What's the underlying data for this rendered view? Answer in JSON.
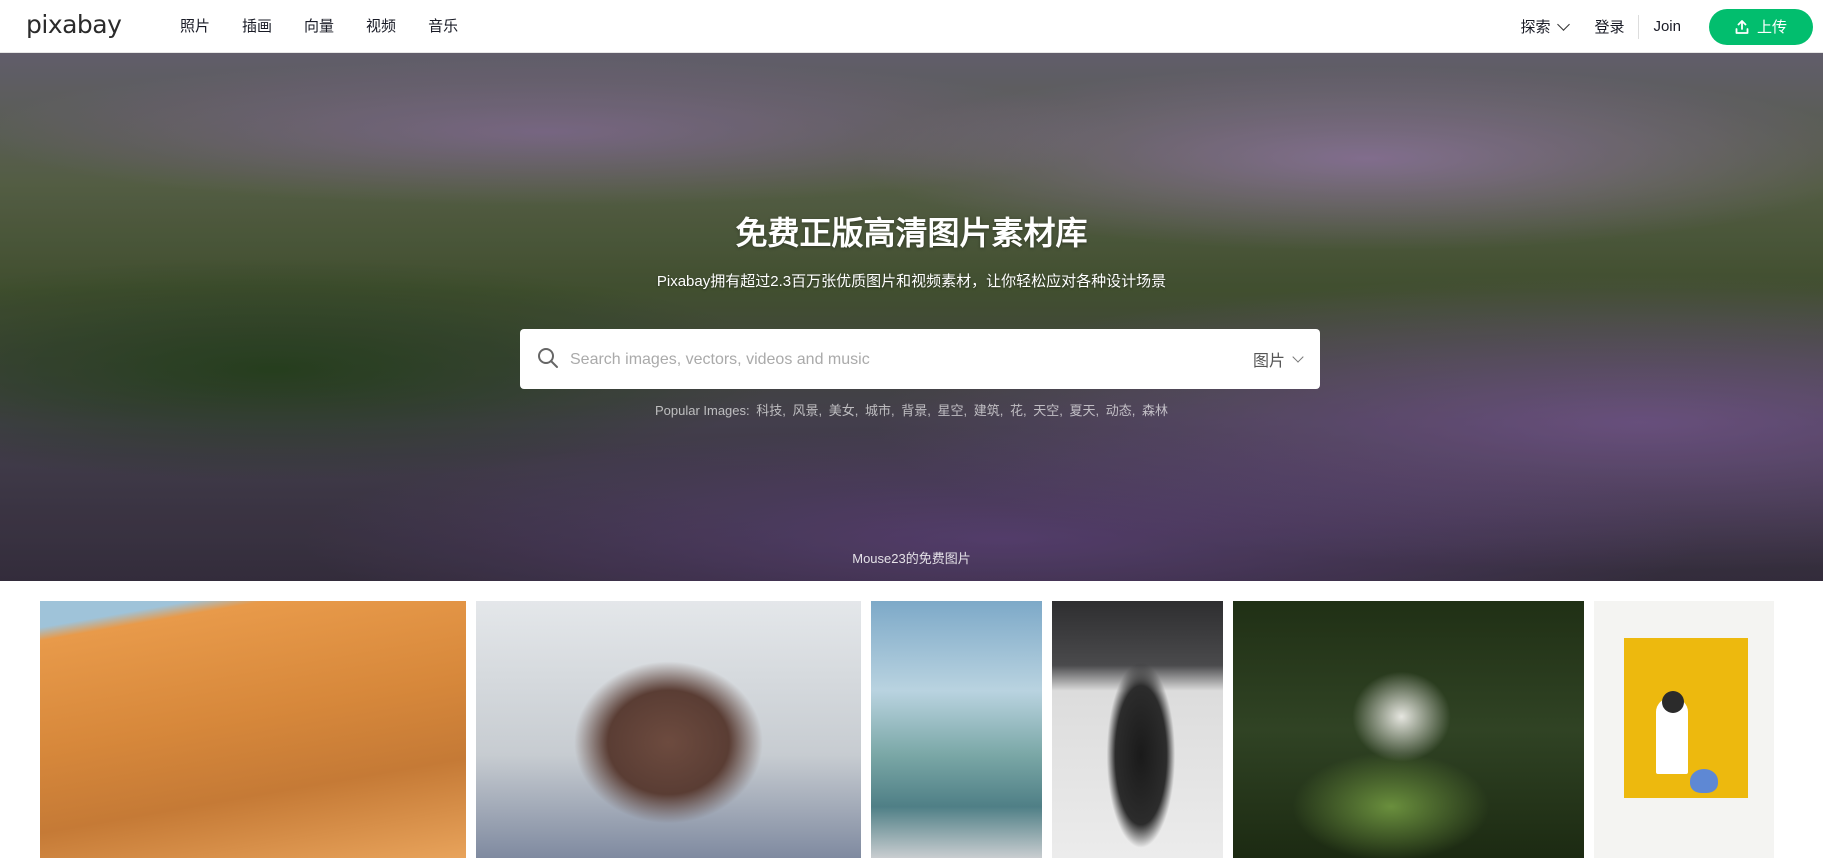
{
  "header": {
    "logo": "pixabay",
    "nav": [
      "照片",
      "插画",
      "向量",
      "视频",
      "音乐"
    ],
    "explore": "探索",
    "login": "登录",
    "join": "Join",
    "upload": "上传"
  },
  "hero": {
    "title": "免费正版高清图片素材库",
    "subtitle": "Pixabay拥有超过2.3百万张优质图片和视频素材，让你轻松应对各种设计场景",
    "search_placeholder": "Search images, vectors, videos and music",
    "search_type": "图片",
    "popular_label": "Popular Images:",
    "popular_tags": [
      "科技,",
      "风景,",
      "美女,",
      "城市,",
      "背景,",
      "星空,",
      "建筑,",
      "花,",
      "天空,",
      "夏天,",
      "动态,",
      "森林"
    ],
    "credit": "Mouse23的免费图片"
  },
  "colors": {
    "accent": "#02be6e"
  }
}
